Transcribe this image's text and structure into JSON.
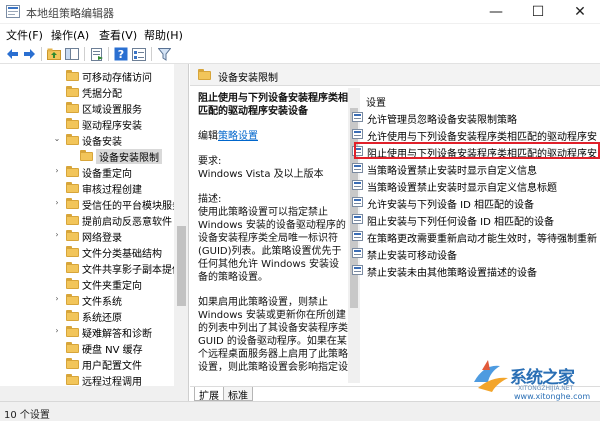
{
  "window": {
    "title": "本地组策略编辑器",
    "min_glyph": "—",
    "max_glyph": "☐",
    "close_glyph": "✕"
  },
  "menu": [
    "文件(F)",
    "操作(A)",
    "查看(V)",
    "帮助(H)"
  ],
  "toolbar": {
    "icons": [
      "back-arrow-icon",
      "forward-arrow-icon",
      "folder-up-icon",
      "show-hide-tree-icon",
      "export-list-icon",
      "help-icon",
      "properties-icon",
      "filter-icon"
    ]
  },
  "tree": {
    "items": [
      {
        "label": "可移动存储访问",
        "expander": ""
      },
      {
        "label": "凭据分配",
        "expander": ""
      },
      {
        "label": "区域设置服务",
        "expander": ""
      },
      {
        "label": "驱动程序安装",
        "expander": ""
      },
      {
        "label": "设备安装",
        "expander": "⌄"
      },
      {
        "label": "设备安装限制",
        "expander": ""
      },
      {
        "label": "设备重定向",
        "expander": "›"
      },
      {
        "label": "审核过程创建",
        "expander": ""
      },
      {
        "label": "受信任的平台模块服务",
        "expander": "›"
      },
      {
        "label": "提前启动反恶意软件",
        "expander": ""
      },
      {
        "label": "网络登录",
        "expander": "›"
      },
      {
        "label": "文件分类基础结构",
        "expander": ""
      },
      {
        "label": "文件共享影子副本提供",
        "expander": ""
      },
      {
        "label": "文件夹重定向",
        "expander": ""
      },
      {
        "label": "文件系统",
        "expander": "›"
      },
      {
        "label": "系统还原",
        "expander": ""
      },
      {
        "label": "疑难解答和诊断",
        "expander": "›"
      },
      {
        "label": "硬盘 NV 缓存",
        "expander": ""
      },
      {
        "label": "用户配置文件",
        "expander": ""
      },
      {
        "label": "远程过程调用",
        "expander": ""
      }
    ]
  },
  "right": {
    "header": "设备安装限制",
    "description": {
      "title": "阻止使用与下列设备安装程序类相匹配的驱动程序安装设备",
      "edit_prefix": "编辑",
      "edit_link": "策略设置",
      "req_label": "要求:",
      "req_value": "Windows Vista 及以上版本",
      "desc_label": "描述:",
      "desc_para1": "使用此策略设置可以指定禁止 Windows 安装的设备驱动程序的设备安装程序类全局唯一标识符(GUID)列表。此策略设置优先于任何其他允许 Windows 安装设备的策略设置。",
      "desc_para2": "如果启用此策略设置，则禁止 Windows 安装或更新你在所创建的列表中列出了其设备安装程序类 GUID 的设备驱动程序。如果在某个远程桌面服务器上启用了此策略设置，则此策略设置会影响指定设"
    },
    "settings_header": "设置",
    "settings": [
      "允许管理员忽略设备安装限制策略",
      "允许使用与下列设备安装程序类相匹配的驱动程序安",
      "阻止使用与下列设备安装程序类相匹配的驱动程序安",
      "当策略设置禁止安装时显示自定义信息",
      "当策略设置禁止安装时显示自定义信息标题",
      "允许安装与下列设备 ID 相匹配的设备",
      "阻止安装与下列任何设备 ID 相匹配的设备",
      "在策略更改需要重新启动才能生效时，等待强制重新",
      "禁止安装可移动设备",
      "禁止安装未由其他策略设置描述的设备"
    ],
    "tabs": [
      "扩展",
      "标准"
    ]
  },
  "status": {
    "text": "10 个设置"
  },
  "watermark": {
    "name": "系统之家",
    "sub": "XITONGZHIJIA.NET",
    "url": "www.xitonghe.com"
  }
}
